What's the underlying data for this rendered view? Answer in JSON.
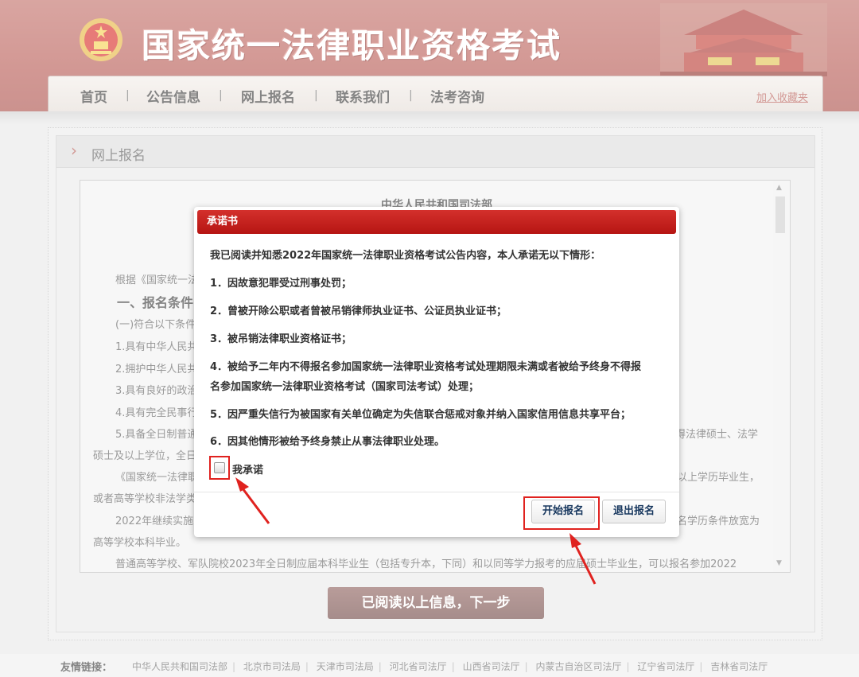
{
  "header": {
    "site_title": "国家统一法律职业资格考试",
    "nav": [
      "首页",
      "公告信息",
      "网上报名",
      "联系我们",
      "法考咨询"
    ],
    "nav_separator": "|",
    "favorite": "加入收藏夹"
  },
  "panel": {
    "title": "网上报名",
    "document_lines": [
      "中华人民共和国司法部",
      "根据《国家统一法",
      "一、报名条件",
      "(一)符合以下条件",
      "1.具有中华人民共",
      "2.拥护中华人民共",
      "3.具有良好的政治",
      "4.具有完全民事行",
      "5.具备全日制普通",
      "得法律硕士、法学",
      "硕士及以上学位，全日",
      "《国家统一法律职",
      "以上学历毕业生，",
      "或者高等学校非法学类",
      "2022年继续实施",
      "名学历条件放宽为",
      "高等学校本科毕业。",
      "普通高等学校、军队院校2023年全日制应届本科毕业生（包括专升本，下同）和以同等学力报考的应届硕士毕业生，可以报名参加2022"
    ],
    "next_button": "已阅读以上信息，下一步"
  },
  "modal": {
    "title": "承诺书",
    "intro": "我已阅读并知悉2022年国家统一法律职业资格考试公告内容，本人承诺无以下情形：",
    "items": [
      "1．因故意犯罪受过刑事处罚；",
      "2．曾被开除公职或者曾被吊销律师执业证书、公证员执业证书；",
      "3．被吊销法律职业资格证书；",
      "4．被给予二年内不得报名参加国家统一法律职业资格考试处理期限未满或者被给予终身不得报",
      "名参加国家统一法律职业资格考试（国家司法考试）处理；",
      "5．因严重失信行为被国家有关单位确定为失信联合惩戒对象并纳入国家信用信息共享平台；",
      "6．因其他情形被给予终身禁止从事法律职业处理。"
    ],
    "checkbox_label": "我承诺",
    "checkbox_checked": false,
    "start_button": "开始报名",
    "exit_button": "退出报名"
  },
  "footer": {
    "label": "友情链接：",
    "links": [
      "中华人民共和国司法部",
      "北京市司法局",
      "天津市司法局",
      "河北省司法厅",
      "山西省司法厅",
      "内蒙古自治区司法厅",
      "辽宁省司法厅",
      "吉林省司法厅"
    ]
  },
  "colors": {
    "header_red": "#b5544d",
    "modal_title_red": "#c41f1b",
    "highlight_red": "#e0221f",
    "button_text": "#17375e"
  }
}
